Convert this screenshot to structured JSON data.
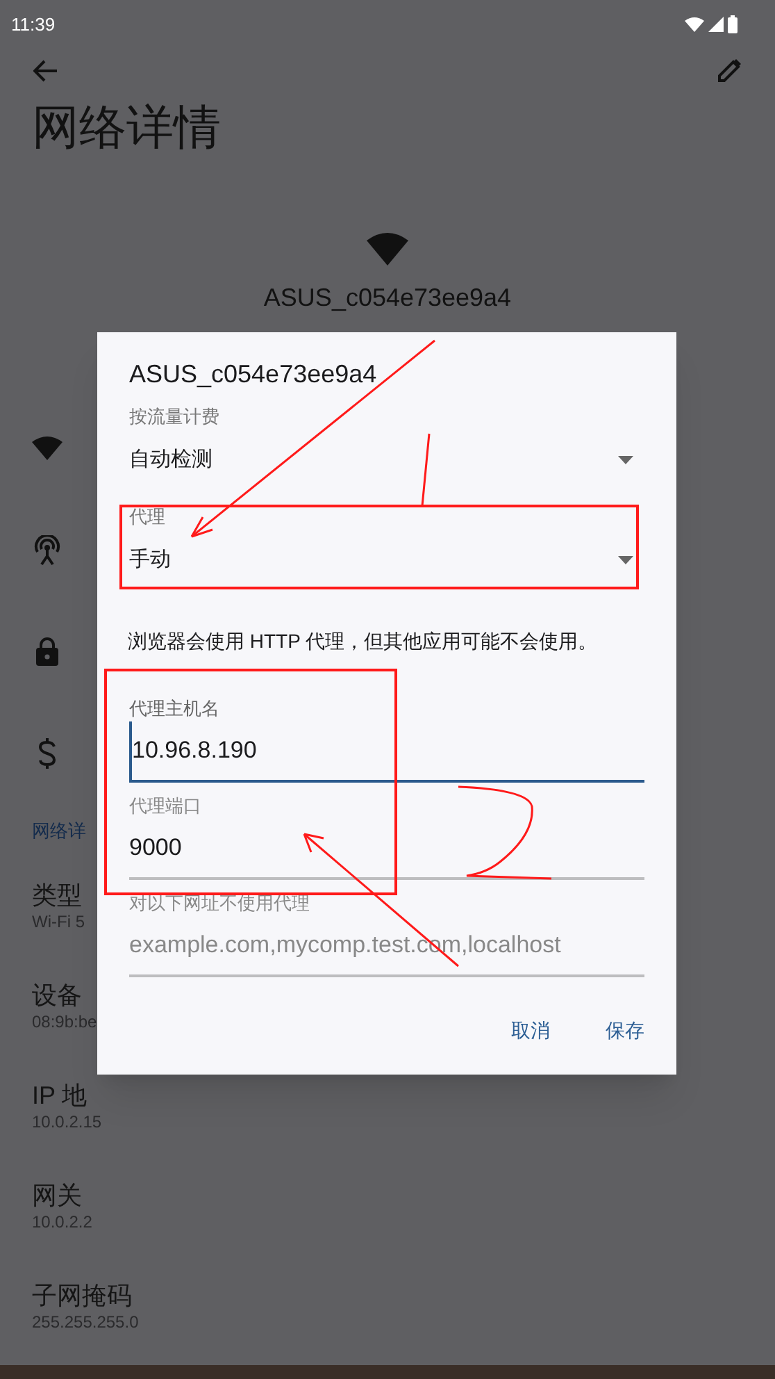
{
  "status_bar": {
    "time": "11:39"
  },
  "app_bar": {
    "title": "网络详情"
  },
  "network": {
    "ssid": "ASUS_c054e73ee9a4"
  },
  "section_header": "网络详",
  "details": [
    {
      "label": "类型",
      "value": "Wi-Fi 5"
    },
    {
      "label": "设备",
      "value": "08:9b:be"
    },
    {
      "label": "IP 地",
      "value": "10.0.2.15"
    },
    {
      "label": "网关",
      "value": "10.0.2.2"
    },
    {
      "label": "子网掩码",
      "value": "255.255.255.0"
    }
  ],
  "dialog": {
    "title": "ASUS_c054e73ee9a4",
    "fields": [
      {
        "kind": "dropdown",
        "label": "按流量计费",
        "value": "自动检测"
      },
      {
        "kind": "dropdown",
        "label": "代理",
        "value": "手动"
      },
      {
        "kind": "note",
        "text": "浏览器会使用 HTTP 代理，但其他应用可能不会使用。"
      },
      {
        "kind": "text",
        "label": "代理主机名",
        "value": "10.96.8.190",
        "focused": true
      },
      {
        "kind": "text",
        "label": "代理端口",
        "value": "9000",
        "focused": false
      },
      {
        "kind": "text",
        "label": "对以下网址不使用代理",
        "placeholder": "example.com,mycomp.test.com,localhost",
        "focused": false
      }
    ],
    "buttons": [
      "取消",
      "保存"
    ]
  }
}
